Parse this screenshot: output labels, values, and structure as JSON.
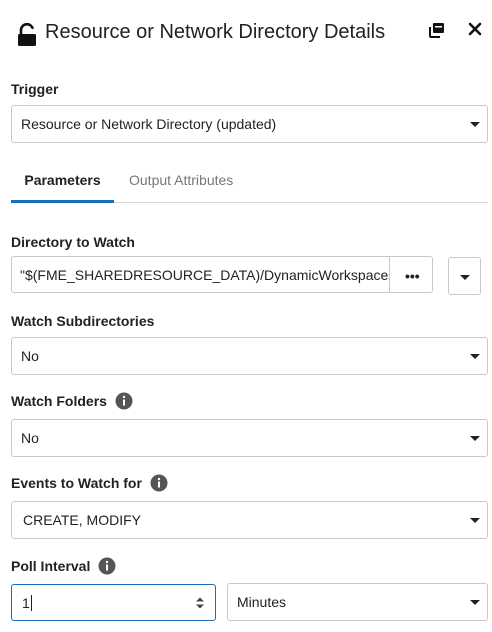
{
  "header": {
    "title": "Resource or Network Directory Details",
    "lock_icon": "unlocked-padlock-icon",
    "popout_icon": "popout-window-icon",
    "close_icon": "close-icon"
  },
  "trigger": {
    "label": "Trigger",
    "value": "Resource or Network Directory (updated)"
  },
  "tabs": [
    {
      "label": "Parameters",
      "active": true
    },
    {
      "label": "Output Attributes",
      "active": false
    }
  ],
  "directory": {
    "label": "Directory to Watch",
    "value": "\"$(FME_SHAREDRESOURCE_DATA)/DynamicWorkspaces\"",
    "browse_label": "•••"
  },
  "watch_subdirectories": {
    "label": "Watch Subdirectories",
    "value": "No"
  },
  "watch_folders": {
    "label": "Watch Folders",
    "value": "No"
  },
  "events": {
    "label": "Events to Watch for",
    "value": "CREATE,  MODIFY"
  },
  "poll_interval": {
    "label": "Poll Interval",
    "value": "1",
    "unit": "Minutes"
  },
  "colors": {
    "accent": "#1a6fb8",
    "border": "#c8c8c8",
    "text": "#222222",
    "muted": "#777777"
  }
}
